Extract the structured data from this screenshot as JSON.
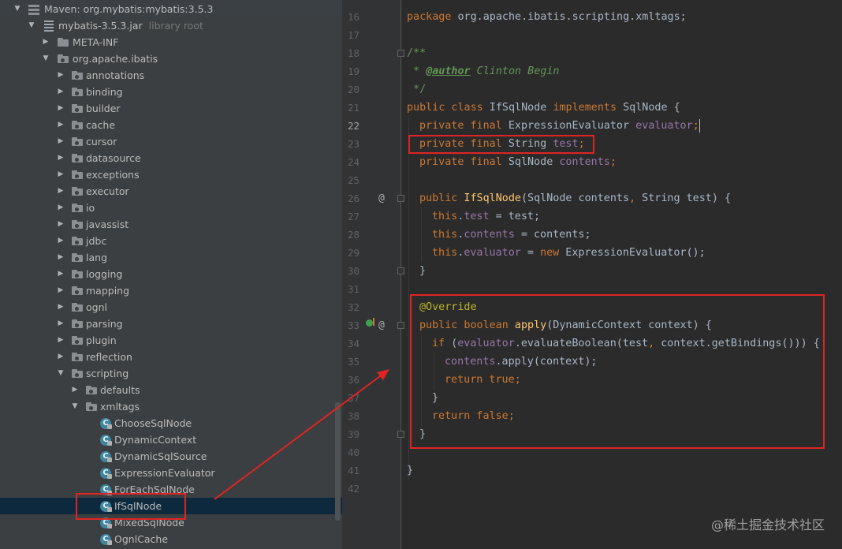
{
  "project_tree": {
    "root_label": "Maven: org.mybatis:mybatis:3.5.3",
    "jar": {
      "label": "mybatis-3.5.3.jar",
      "suffix": "library root"
    },
    "meta_inf": "META-INF",
    "root_package": "org.apache.ibatis",
    "packages": [
      "annotations",
      "binding",
      "builder",
      "cache",
      "cursor",
      "datasource",
      "exceptions",
      "executor",
      "io",
      "javassist",
      "jdbc",
      "lang",
      "logging",
      "mapping",
      "ognl",
      "parsing",
      "plugin",
      "reflection",
      "scripting"
    ],
    "scripting_children": [
      "defaults",
      "xmltags"
    ],
    "xmltags_classes": [
      "ChooseSqlNode",
      "DynamicContext",
      "DynamicSqlSource",
      "ExpressionEvaluator",
      "ForEachSqlNode",
      "IfSqlNode",
      "MixedSqlNode",
      "OgnlCache"
    ],
    "selected": "IfSqlNode"
  },
  "editor": {
    "line_numbers": [
      "16",
      "17",
      "18",
      "19",
      "20",
      "21",
      "22",
      "23",
      "24",
      "25",
      "26",
      "27",
      "28",
      "29",
      "30",
      "31",
      "32",
      "33",
      "34",
      "35",
      "36",
      "37",
      "38",
      "39",
      "40",
      "41",
      "42"
    ],
    "current_line": "22",
    "lines": {
      "l16": {
        "kw": "package",
        "rest": " org.apache.ibatis.scripting.xmltags;"
      },
      "l18": "/**",
      "l19": {
        "star": " * ",
        "tag": "@author",
        "name": " Clinton Begin"
      },
      "l20": " */",
      "l21": {
        "kw": "public class",
        "name": " IfSqlNode ",
        "kw2": "implements",
        "rest": " SqlNode {"
      },
      "l22": {
        "kw": "private final",
        "type": " ExpressionEvaluator ",
        "field": "evaluator",
        "end": ";"
      },
      "l23": {
        "kw": "private final",
        "type": " String ",
        "field": "test",
        "end": ";"
      },
      "l24": {
        "kw": "private final",
        "type": " SqlNode ",
        "field": "contents",
        "end": ";"
      },
      "l26": {
        "kw": "public",
        "fn": " IfSqlNode",
        "p1": "(SqlNode contents",
        "c1": ",",
        "p2": " String test) {"
      },
      "l27": {
        "kw": "this",
        "dot": ".",
        "field": "test",
        "rest": " = test;"
      },
      "l28": {
        "kw": "this",
        "dot": ".",
        "field": "contents",
        "rest": " = contents;"
      },
      "l29": {
        "kw": "this",
        "dot": ".",
        "field": "evaluator",
        "eq": " = ",
        "kw2": "new",
        "rest": " ExpressionEvaluator();"
      },
      "l30": "}",
      "l32": "@Override",
      "l33": {
        "kw": "public boolean",
        "fn": " apply",
        "rest": "(DynamicContext context) {"
      },
      "l34": {
        "kw": "if",
        "p1": " (",
        "field": "evaluator",
        "p2": ".evaluateBoolean(test",
        "c1": ",",
        "p3": " context.getBindings())) {"
      },
      "l35": {
        "field": "contents",
        "rest": ".apply(context);"
      },
      "l36": {
        "kw": "return",
        "kw2": " true",
        "end": ";"
      },
      "l37": "}",
      "l38": {
        "kw": "return",
        "kw2": " false",
        "end": ";"
      },
      "l39": "}",
      "l41": "}"
    },
    "gutter_marks": {
      "at26": "@",
      "at33": "@"
    }
  },
  "watermark": "@稀土掘金技术社区",
  "colors": {
    "highlight_box": "#e02424",
    "selection": "#0d293e",
    "accent_class_icon": "#3e86a0"
  }
}
